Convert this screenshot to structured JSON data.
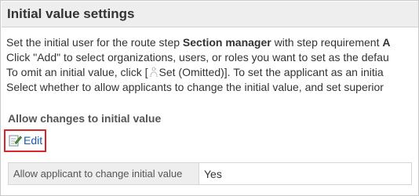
{
  "title": "Initial value settings",
  "description": {
    "line1_prefix": "Set the initial user for the route step ",
    "line1_bold1": "Section manager",
    "line1_mid": " with step requirement ",
    "line1_bold2": "A",
    "line2": "Click \"Add\" to select organizations, users, or roles you want to set as the defau",
    "line3_prefix": "To omit an initial value, click [",
    "line3_link": "Set (Omitted)",
    "line3_suffix": "]. To set the applicant as an initia",
    "line4": "Select whether to allow applicants to change the initial value, and set superior"
  },
  "section_heading": "Allow changes to initial value",
  "edit_label": "Edit",
  "table": {
    "header": "Allow applicant to change initial value",
    "value": "Yes"
  }
}
